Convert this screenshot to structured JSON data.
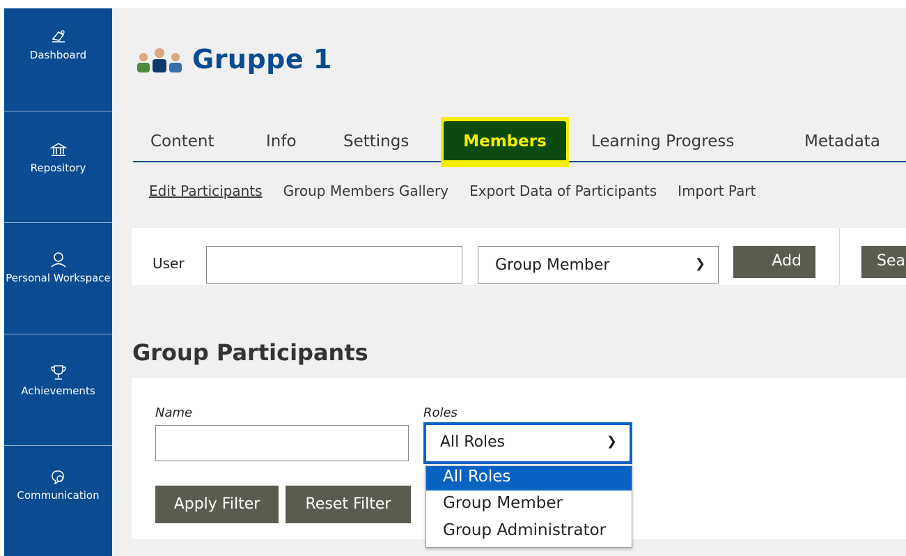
{
  "sidebar": {
    "items": [
      {
        "label": "Dashboard",
        "icon": "dashboard-icon"
      },
      {
        "label": "Repository",
        "icon": "repository-icon"
      },
      {
        "label": "Personal Workspace",
        "icon": "personal-workspace-icon"
      },
      {
        "label": "Achievements",
        "icon": "trophy-icon"
      },
      {
        "label": "Communication",
        "icon": "communication-icon"
      }
    ]
  },
  "header": {
    "title": "Gruppe 1",
    "icon": "group-icon"
  },
  "tabs": {
    "items": [
      "Content",
      "Info",
      "Settings",
      "Members",
      "Learning Progress",
      "Metadata"
    ],
    "active": "Members"
  },
  "subtabs": [
    "Edit Participants",
    "Group Members Gallery",
    "Export Data of Participants",
    "Import Part"
  ],
  "toolbar": {
    "user_label": "User",
    "user_value": "",
    "role_select": "Group Member",
    "add_label": "Add",
    "search_label": "Sea"
  },
  "section": {
    "title": "Group Participants"
  },
  "filter": {
    "name_label": "Name",
    "name_value": "",
    "roles_label": "Roles",
    "roles_selected": "All Roles",
    "apply_label": "Apply Filter",
    "reset_label": "Reset Filter"
  },
  "roles_dropdown": {
    "options": [
      "All Roles",
      "Group Member",
      "Group Administrator"
    ],
    "highlighted": "All Roles"
  },
  "colors": {
    "sidebar": "#0a4b91",
    "accent": "#0a4b91",
    "active_tab_bg": "#0c4a10",
    "active_tab_text": "#f5ee00",
    "button": "#5b5b4f",
    "focus": "#0a62c2"
  }
}
